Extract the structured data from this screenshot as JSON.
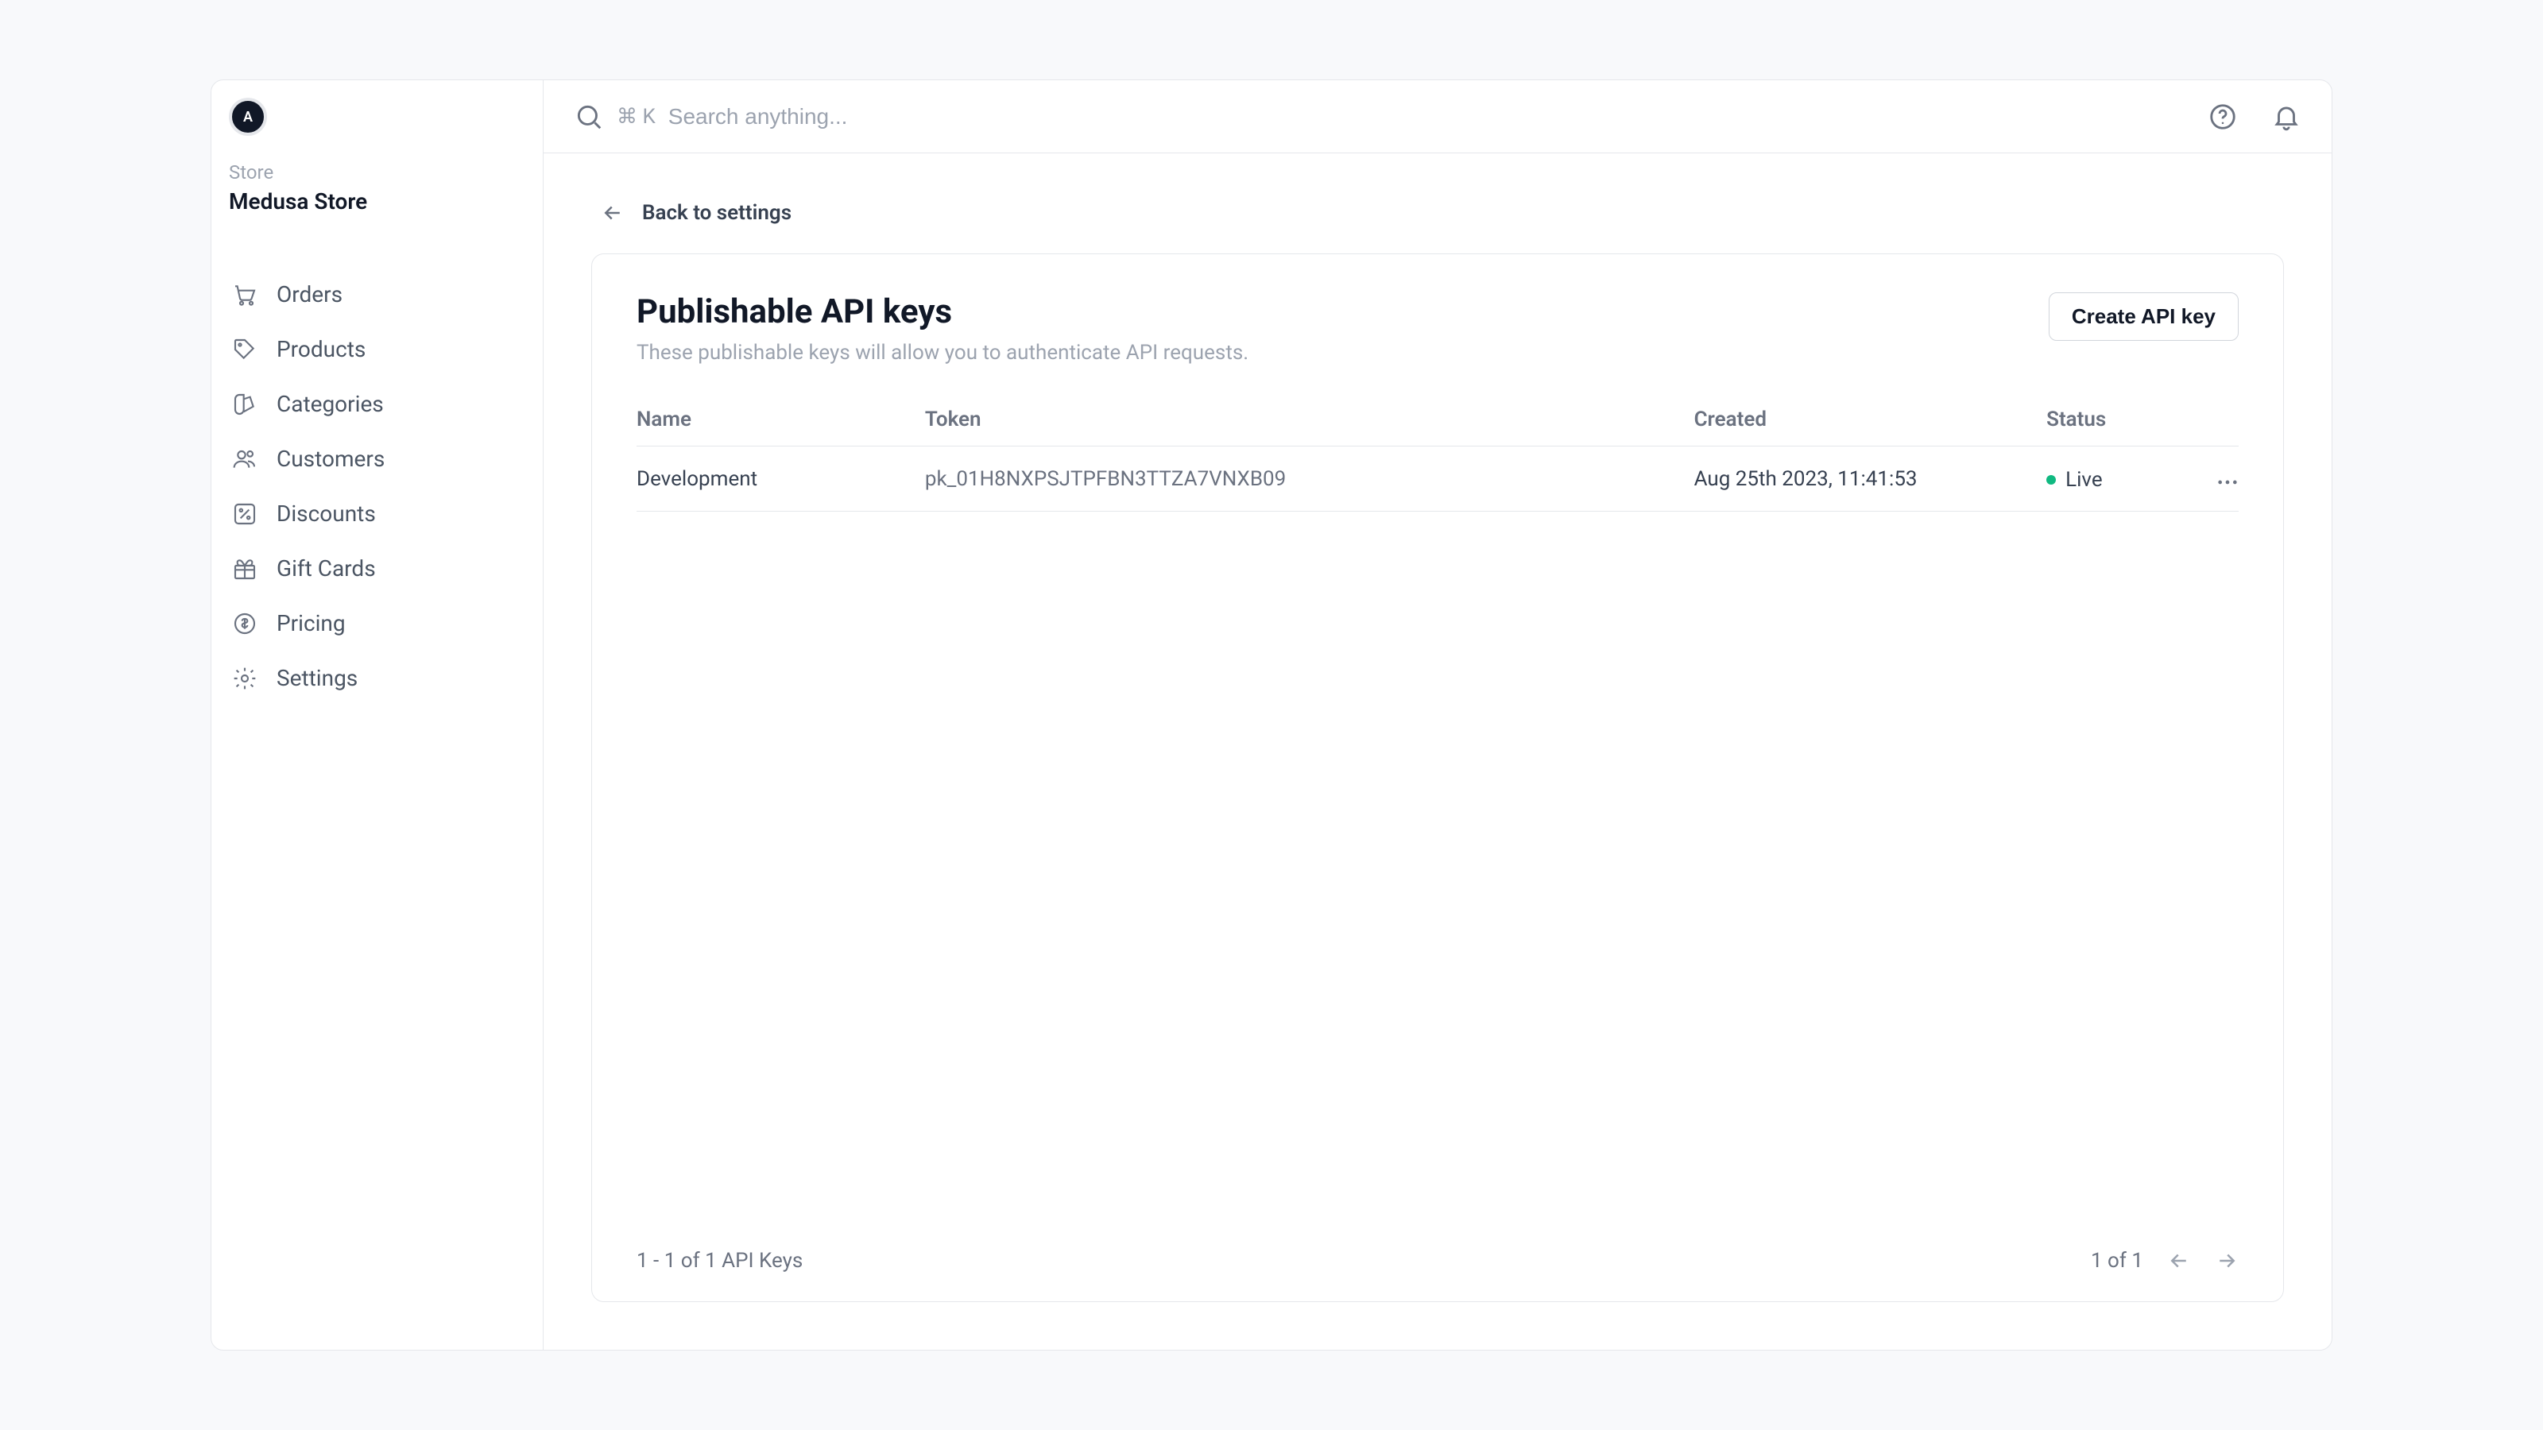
{
  "sidebar": {
    "avatar_initial": "A",
    "store_label": "Store",
    "store_name": "Medusa Store",
    "items": [
      {
        "label": "Orders"
      },
      {
        "label": "Products"
      },
      {
        "label": "Categories"
      },
      {
        "label": "Customers"
      },
      {
        "label": "Discounts"
      },
      {
        "label": "Gift Cards"
      },
      {
        "label": "Pricing"
      },
      {
        "label": "Settings"
      }
    ]
  },
  "topbar": {
    "kbd_hint": "⌘ K",
    "search_placeholder": "Search anything..."
  },
  "page": {
    "back_label": "Back to settings",
    "title": "Publishable API keys",
    "subtitle": "These publishable keys will allow you to authenticate API requests.",
    "create_button": "Create API key",
    "table": {
      "columns": {
        "name": "Name",
        "token": "Token",
        "created": "Created",
        "status": "Status"
      },
      "rows": [
        {
          "name": "Development",
          "token": "pk_01H8NXPSJTPFBN3TTZA7VNXB09",
          "created": "Aug 25th 2023, 11:41:53",
          "status": "Live"
        }
      ]
    },
    "footer": {
      "range_text": "1 - 1 of 1 API Keys",
      "page_text": "1 of 1"
    }
  }
}
